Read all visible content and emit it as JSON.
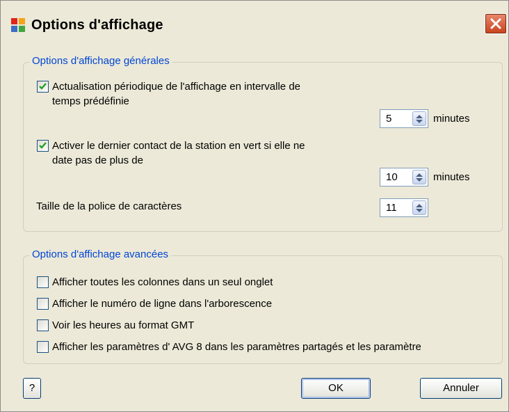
{
  "window": {
    "title": "Options d'affichage",
    "icon": "avg-logo-icon",
    "close_icon": "close-icon"
  },
  "general": {
    "label": "Options d'affichage générales",
    "refresh": {
      "checked": true,
      "line1": "Actualisation périodique de l'affichage en intervalle de",
      "line2": "temps prédéfinie",
      "value": "5",
      "unit": "minutes"
    },
    "green": {
      "checked": true,
      "line1": "Activer le dernier contact de la station en vert si elle ne",
      "line2": "date pas de plus de",
      "value": "10",
      "unit": "minutes"
    },
    "font_size": {
      "label": "Taille de la police de caractères",
      "value": "11"
    }
  },
  "advanced": {
    "label": "Options d'affichage avancées",
    "items": [
      {
        "label": "Afficher toutes les colonnes dans un seul onglet",
        "checked": false
      },
      {
        "label": "Afficher le numéro de ligne dans l'arborescence",
        "checked": false
      },
      {
        "label": "Voir les heures au format GMT",
        "checked": false
      },
      {
        "label": "Afficher les paramètres d' AVG 8 dans les paramètres partagés et les paramètre",
        "checked": false
      }
    ]
  },
  "buttons": {
    "help": "?",
    "ok": "OK",
    "cancel": "Annuler"
  },
  "colors": {
    "accent": "#0046d5",
    "check": "#21a121",
    "close": "#c8421d"
  }
}
